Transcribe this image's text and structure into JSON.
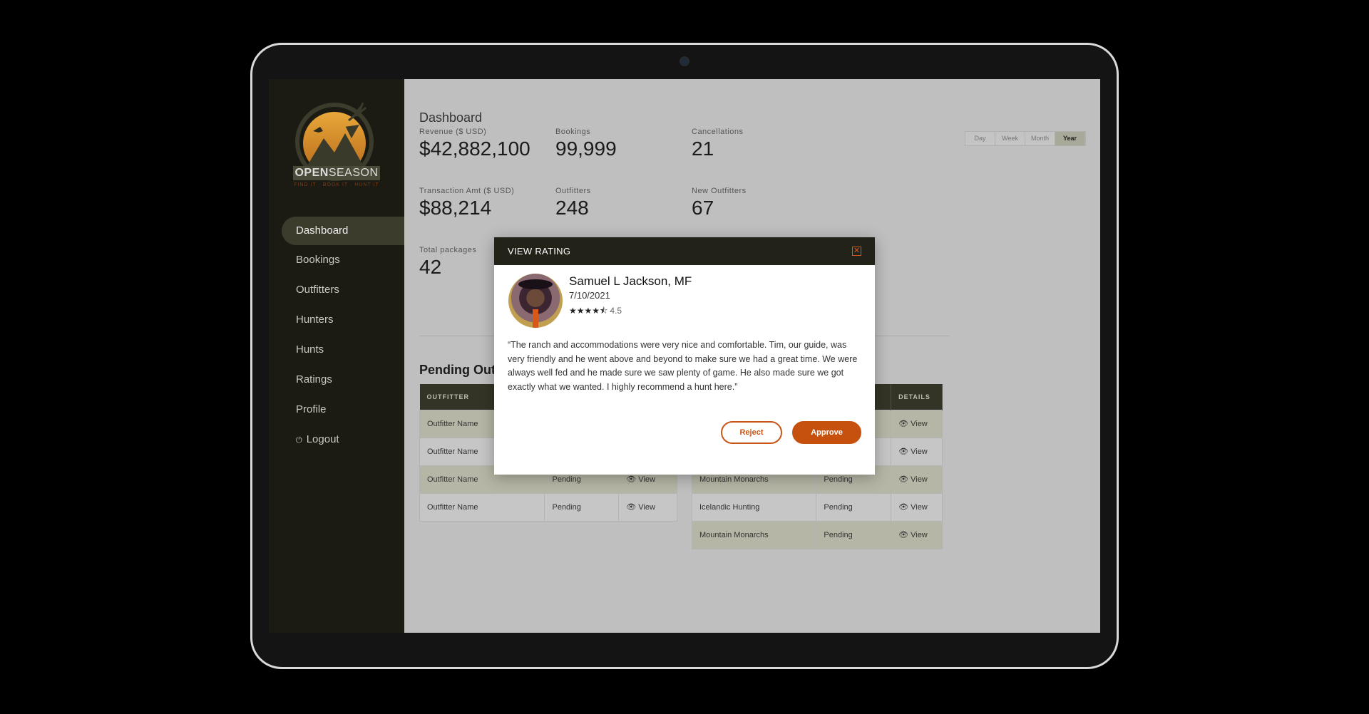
{
  "brand": {
    "name_bold": "OPEN",
    "name_rest": "SEASON",
    "tagline": "FIND IT · BOOK IT · HUNT IT"
  },
  "sidebar": {
    "items": [
      {
        "label": "Dashboard",
        "active": true
      },
      {
        "label": "Bookings"
      },
      {
        "label": "Outfitters"
      },
      {
        "label": "Hunters"
      },
      {
        "label": "Hunts"
      },
      {
        "label": "Ratings"
      },
      {
        "label": "Profile"
      },
      {
        "label": "Logout",
        "icon": "logout-icon"
      }
    ]
  },
  "main": {
    "title": "Dashboard",
    "periods": [
      "Day",
      "Week",
      "Month",
      "Year"
    ],
    "selected_period": "Year",
    "stats": [
      {
        "label": "Revenue ($ USD)",
        "value": "$42,882,100"
      },
      {
        "label": "Bookings",
        "value": "99,999"
      },
      {
        "label": "Cancellations",
        "value": "21"
      },
      {
        "label": "Transaction Amt ($ USD)",
        "value": "$88,214"
      },
      {
        "label": "Outfitters",
        "value": "248"
      },
      {
        "label": "New Outfitters",
        "value": "67"
      },
      {
        "label": "Total packages",
        "value": "42"
      }
    ],
    "pending_title": "Pending Outf",
    "left_table": {
      "headers": [
        "OUTFITTER",
        "",
        ""
      ],
      "rows": [
        [
          "Outfitter Name",
          "",
          ""
        ],
        [
          "Outfitter Name",
          "",
          ""
        ],
        [
          "Outfitter Name",
          "Pending",
          "View"
        ],
        [
          "Outfitter Name",
          "Pending",
          "View"
        ]
      ]
    },
    "right_table": {
      "headers": [
        "",
        "",
        "DETAILS"
      ],
      "rows": [
        [
          "",
          "",
          "View"
        ],
        [
          "",
          "",
          "View"
        ],
        [
          "Mountain Monarchs",
          "Pending",
          "View"
        ],
        [
          "Icelandic Hunting",
          "Pending",
          "View"
        ],
        [
          "Mountain Monarchs",
          "Pending",
          "View"
        ]
      ]
    }
  },
  "modal": {
    "title": "VIEW RATING",
    "name": "Samuel L Jackson, MF",
    "date": "7/10/2021",
    "rating": 4.5,
    "rating_text": "4.5",
    "quote": "“The ranch and accommodations were very nice and comfortable. Tim, our guide, was very friendly and he went above and beyond to make sure we had a great time. We were always well fed and he made sure we saw plenty of game. He also made sure we got exactly what we wanted. I highly recommend a hunt here.”",
    "reject_label": "Reject",
    "approve_label": "Approve"
  },
  "colors": {
    "accent": "#c6510f",
    "sidebar": "#1b1b13",
    "table_header": "#343426"
  }
}
